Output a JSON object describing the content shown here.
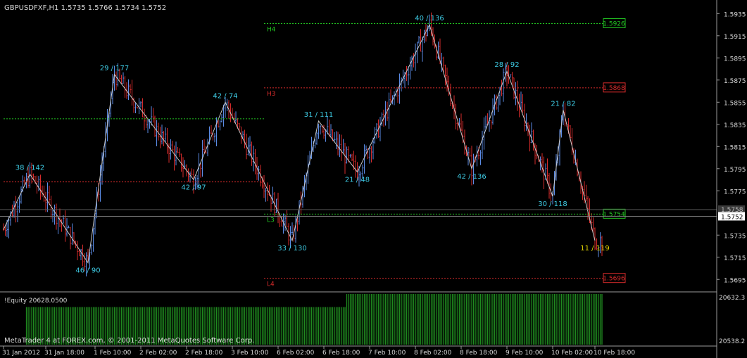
{
  "header": {
    "symbol_info": "GBPUSDFXF,H1  1.5735 1.5766 1.5734 1.5752"
  },
  "footer": {
    "copyright": "MetaTrader 4 at FOREX.com, © 2001-2011 MetaQuotes Software Corp."
  },
  "colors": {
    "background": "#000000",
    "bull_bar": "#5b8ce6",
    "bear_bar": "#d62b2b",
    "zigzag_line": "#c8c8c8",
    "zigzag_label": "#3ecbe4",
    "current_swing_label": "#e6d800",
    "support_level": "#22c322",
    "resistance_level": "#d62b2b",
    "axis_text": "#d9d9d9",
    "equity_bar": "#1f8a1f",
    "separator": "#9a9a9a",
    "current_price_box_bg": "#ffffff",
    "current_price_box_fg": "#000000"
  },
  "chart_data": [
    {
      "type": "candlestick",
      "title": "GBPUSDFXF,H1  1.5735 1.5766 1.5734 1.5752",
      "ylim": [
        1.5685,
        1.5946
      ],
      "grid": false,
      "y_tick_labels": [
        "1.5935",
        "1.5915",
        "1.5895",
        "1.5875",
        "1.5855",
        "1.5835",
        "1.5815",
        "1.5795",
        "1.5775",
        "1.5735",
        "1.5715",
        "1.5695"
      ],
      "x_tick_labels": [
        "31 Jan 2012",
        "31 Jan 18:00",
        "1 Feb 10:00",
        "2 Feb 02:00",
        "2 Feb 18:00",
        "3 Feb 10:00",
        "6 Feb 02:00",
        "6 Feb 18:00",
        "7 Feb 10:00",
        "8 Feb 02:00",
        "8 Feb 18:00",
        "9 Feb 10:00",
        "10 Feb 02:00",
        "10 Feb 18:00"
      ],
      "current_price": "1.5752",
      "second_price_label": "1.5758",
      "zigzag_points": [
        {
          "index": 0,
          "price": 1.574
        },
        {
          "index": 15,
          "price": 1.579,
          "label": "38 / 142"
        },
        {
          "index": 48,
          "price": 1.571,
          "label": "46 / 90"
        },
        {
          "index": 63,
          "price": 1.588,
          "label": "29 / 177"
        },
        {
          "index": 108,
          "price": 1.5785,
          "label": "42 / 97"
        },
        {
          "index": 126,
          "price": 1.5855,
          "label": "42 / 74"
        },
        {
          "index": 164,
          "price": 1.573,
          "label": "33 / 130"
        },
        {
          "index": 179,
          "price": 1.5838,
          "label": "31 / 111"
        },
        {
          "index": 201,
          "price": 1.5792,
          "label": "21 / 48"
        },
        {
          "index": 242,
          "price": 1.5925,
          "label": "40 / 136"
        },
        {
          "index": 266,
          "price": 1.5795,
          "label": "42 / 136"
        },
        {
          "index": 286,
          "price": 1.5883,
          "label": "28 / 92"
        },
        {
          "index": 312,
          "price": 1.577,
          "label": "30 / 118"
        },
        {
          "index": 318,
          "price": 1.5848,
          "label": "21 / 82"
        },
        {
          "index": 336,
          "price": 1.573,
          "label": "11 / 119",
          "current": true
        }
      ],
      "levels": [
        {
          "name": "H4",
          "price": 1.5926,
          "label": "1.5926",
          "kind": "support",
          "start_index": 148
        },
        {
          "name": "H3",
          "price": 1.5868,
          "label": "1.5868",
          "kind": "resistance",
          "start_index": 148
        },
        {
          "name": "",
          "price": 1.584,
          "label": "",
          "kind": "support",
          "start_index": 0,
          "end_index": 148
        },
        {
          "name": "",
          "price": 1.5783,
          "label": "",
          "kind": "resistance",
          "start_index": 0,
          "end_index": 148
        },
        {
          "name": "L3",
          "price": 1.5754,
          "label": "1.5754",
          "kind": "support",
          "start_index": 148
        },
        {
          "name": "L4",
          "price": 1.5696,
          "label": "1.5696",
          "kind": "resistance",
          "start_index": 148
        }
      ]
    },
    {
      "type": "bar",
      "title": "!Equity 20628.0500",
      "ylim": [
        20538.2,
        20632.3
      ],
      "y_tick_labels": [
        "20632.3",
        "20538.2"
      ],
      "segments": [
        {
          "from_index": 0,
          "to_index": 13,
          "value": null
        },
        {
          "from_index": 13,
          "to_index": 195,
          "value": 20608
        },
        {
          "from_index": 195,
          "to_index": 341,
          "value": 20632.3
        }
      ]
    }
  ]
}
